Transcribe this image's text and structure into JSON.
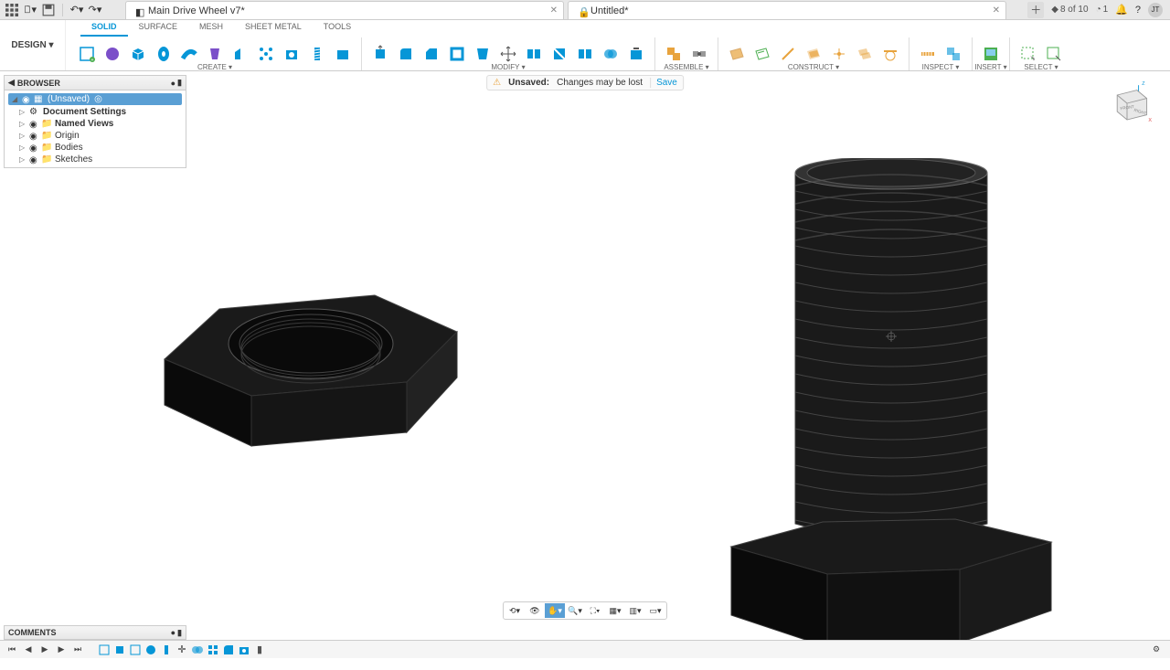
{
  "titlebar": {
    "tab1": "Main Drive Wheel v7*",
    "tab2": "Untitled*",
    "extensions": "8 of 10",
    "jobs": "1",
    "avatar": "JT"
  },
  "workspace": {
    "label": "DESIGN ▾"
  },
  "context_tabs": [
    "SOLID",
    "SURFACE",
    "MESH",
    "SHEET METAL",
    "TOOLS"
  ],
  "groups": {
    "create": "CREATE ▾",
    "modify": "MODIFY ▾",
    "assemble": "ASSEMBLE ▾",
    "construct": "CONSTRUCT ▾",
    "inspect": "INSPECT ▾",
    "insert": "INSERT ▾",
    "select": "SELECT ▾"
  },
  "banner": {
    "unsaved": "Unsaved:",
    "msg": "Changes may be lost",
    "save": "Save"
  },
  "browser": {
    "title": "BROWSER",
    "root": "(Unsaved)",
    "items": [
      "Document Settings",
      "Named Views",
      "Origin",
      "Bodies",
      "Sketches"
    ]
  },
  "comments": "COMMENTS"
}
